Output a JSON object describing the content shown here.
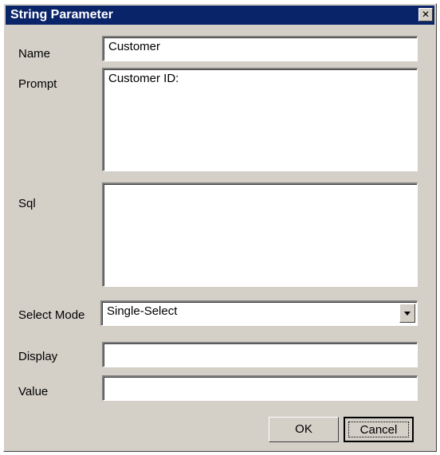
{
  "window": {
    "title": "String Parameter",
    "close_glyph": "✕"
  },
  "form": {
    "name_label": "Name",
    "name_value": "Customer",
    "prompt_label": "Prompt",
    "prompt_value": "Customer ID:",
    "sql_label": "Sql",
    "sql_value": "",
    "select_mode_label": "Select Mode",
    "select_mode_value": "Single-Select",
    "display_label": "Display",
    "display_value": "",
    "value_label": "Value",
    "value_value": ""
  },
  "buttons": {
    "ok_label": "OK",
    "cancel_label": "Cancel"
  },
  "colors": {
    "title_bar": "#0a246a",
    "face": "#d4d0c8"
  }
}
